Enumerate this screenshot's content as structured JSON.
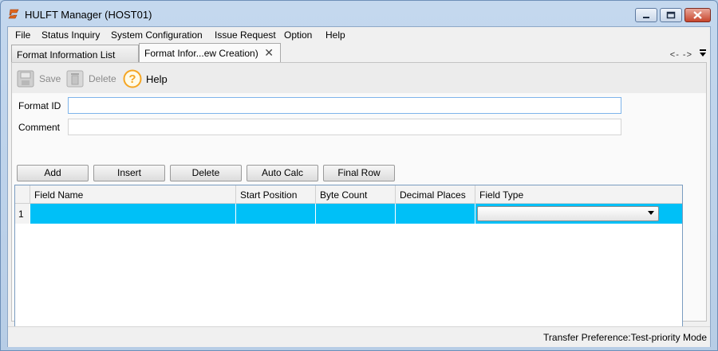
{
  "window": {
    "title": "HULFT Manager (HOST01)"
  },
  "menu": {
    "items": [
      "File",
      "Status Inquiry",
      "System Configuration",
      "Issue Request",
      "Option",
      "Help"
    ]
  },
  "tabs": {
    "items": [
      {
        "label": "Format Information List",
        "active": false
      },
      {
        "label": "Format Infor...ew Creation)",
        "active": true
      }
    ],
    "nav": "<-  ->"
  },
  "toolbar": {
    "save_label": "Save",
    "delete_label": "Delete",
    "help_label": "Help"
  },
  "form": {
    "format_id_label": "Format ID",
    "format_id_value": "",
    "comment_label": "Comment",
    "comment_value": ""
  },
  "actions": {
    "add_label": "Add",
    "insert_label": "Insert",
    "delete_label": "Delete",
    "auto_calc_label": "Auto Calc",
    "final_row_label": "Final Row"
  },
  "grid": {
    "columns": [
      "Field Name",
      "Start Position",
      "Byte Count",
      "Decimal Places",
      "Field Type"
    ],
    "rows": [
      {
        "num": "1",
        "field_name": "",
        "start_position": "",
        "byte_count": "",
        "decimal_places": "",
        "field_type": ""
      }
    ],
    "selected_row_color": "#00c0f7"
  },
  "status": {
    "text": "Transfer Preference:Test-priority Mode"
  },
  "colors": {
    "accent": "#00c0f7",
    "close_button": "#c7462d",
    "help_icon": "#f5a623"
  }
}
